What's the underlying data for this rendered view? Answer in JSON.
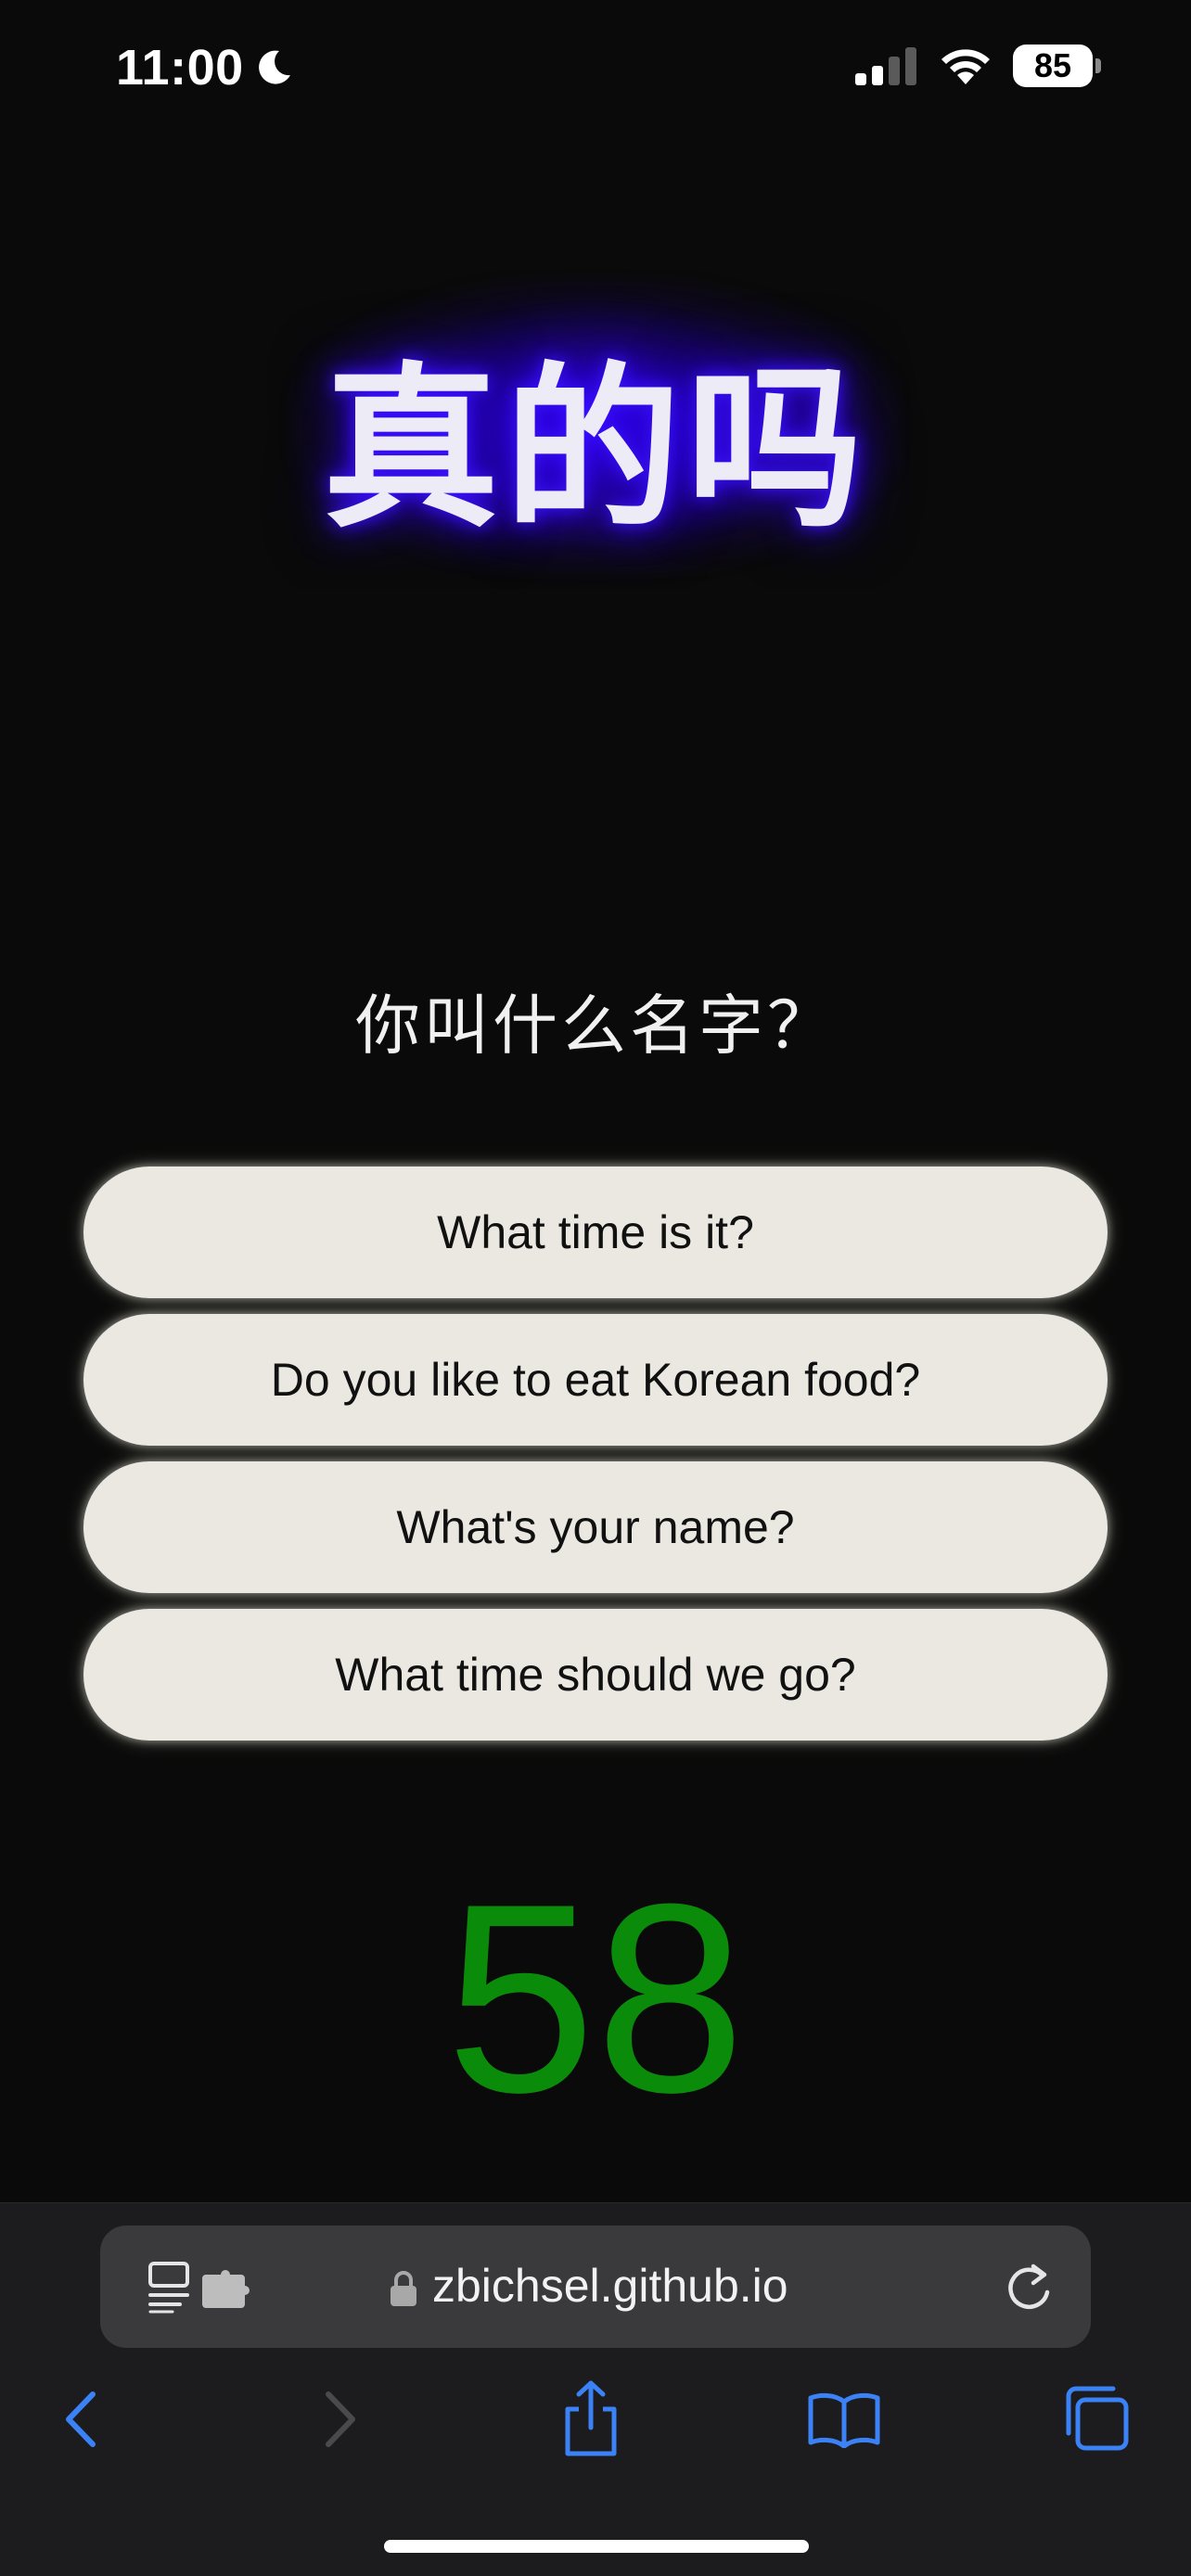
{
  "status_bar": {
    "time": "11:00",
    "battery": "85"
  },
  "title": "真的吗",
  "question": "你叫什么名字？",
  "options": [
    {
      "label": "What time is it?"
    },
    {
      "label": "Do you like to eat Korean food?"
    },
    {
      "label": "What's your name?"
    },
    {
      "label": "What time should we go?"
    }
  ],
  "counter": "58",
  "browser": {
    "url": "zbichsel.github.io"
  },
  "colors": {
    "background": "#0a0a0a",
    "title_glow": "#3200ff",
    "option_bg": "#eae8e1",
    "counter": "#0a8c0a",
    "browser_accent": "#3b82f6"
  },
  "icons": [
    "moon-icon",
    "signal-icon",
    "wifi-icon",
    "battery-icon",
    "page-menu-icon",
    "lock-icon",
    "reload-icon",
    "back-icon",
    "forward-icon",
    "share-icon",
    "bookmarks-icon",
    "tabs-icon"
  ]
}
